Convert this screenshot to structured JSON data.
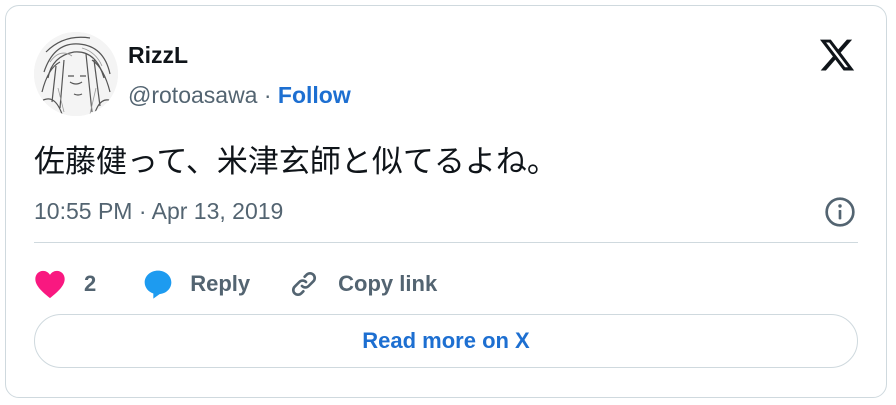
{
  "author": {
    "name": "RizzL",
    "handle": "@rotoasawa",
    "separator": " · ",
    "follow_label": "Follow"
  },
  "tweet": {
    "text": "佐藤健って、米津玄師と似てるよね。",
    "timestamp": "10:55 PM · Apr 13, 2019"
  },
  "actions": {
    "like_count": "2",
    "reply_label": "Reply",
    "copy_link_label": "Copy link"
  },
  "read_more_label": "Read more on X",
  "icons": {
    "brand": "x-logo-icon",
    "info": "info-icon",
    "like": "heart-icon",
    "reply": "reply-bubble-icon",
    "copy": "link-icon"
  },
  "colors": {
    "like": "#f91880",
    "reply": "#1d9bf0",
    "link": "#1d6fd1",
    "secondary_text": "#536471",
    "border": "#cfd9de"
  }
}
